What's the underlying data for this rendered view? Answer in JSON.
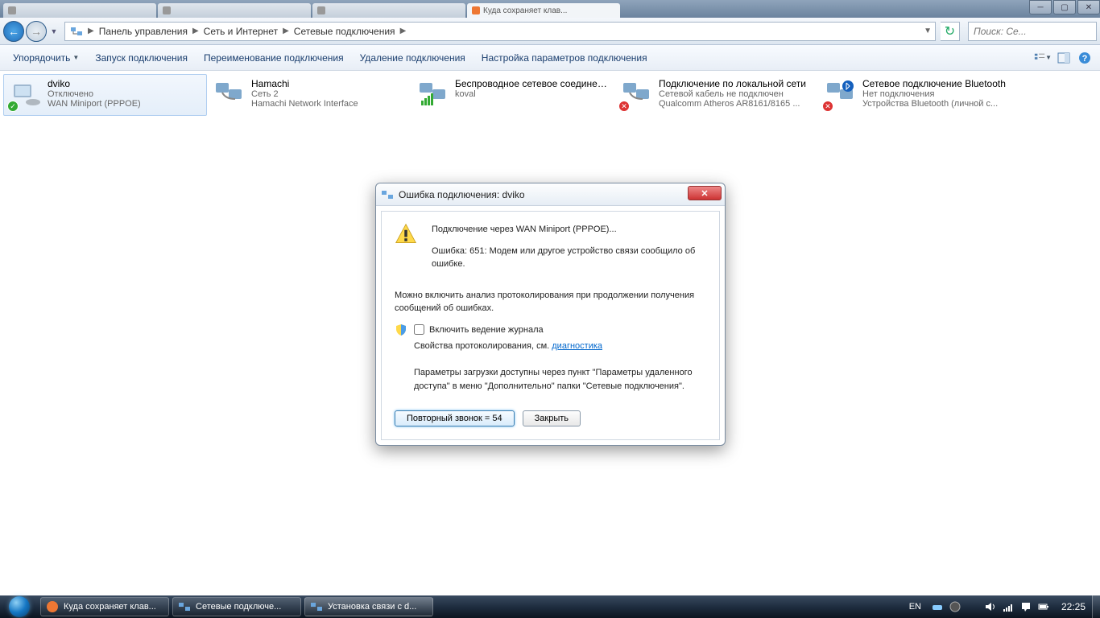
{
  "window_controls": {
    "min": "─",
    "max": "▢",
    "close": "✕"
  },
  "browser_tabs": [
    {
      "label": ""
    },
    {
      "label": ""
    },
    {
      "label": ""
    },
    {
      "label": "Куда сохраняет клав..."
    }
  ],
  "breadcrumb": {
    "root": "Панель управления",
    "items": [
      "Сеть и Интернет",
      "Сетевые подключения"
    ]
  },
  "search_placeholder": "Поиск: Се...",
  "toolbar": {
    "organize": "Упорядочить",
    "start": "Запуск подключения",
    "rename": "Переименование подключения",
    "delete": "Удаление подключения",
    "settings": "Настройка параметров подключения"
  },
  "connections": [
    {
      "name": "dviko",
      "status": "Отключено",
      "detail": "WAN Miniport (PPPOE)",
      "overlay": "green",
      "selected": true
    },
    {
      "name": "Hamachi",
      "status": "Сеть 2",
      "detail": "Hamachi Network Interface",
      "overlay": "",
      "selected": false
    },
    {
      "name": "Беспроводное сетевое соединение",
      "status": "koval",
      "detail": "",
      "overlay": "",
      "selected": false
    },
    {
      "name": "Подключение по локальной сети",
      "status": "Сетевой кабель не подключен",
      "detail": "Qualcomm Atheros AR8161/8165 ...",
      "overlay": "red",
      "selected": false
    },
    {
      "name": "Сетевое подключение Bluetooth",
      "status": "Нет подключения",
      "detail": "Устройства Bluetooth (личной с...",
      "overlay": "red",
      "selected": false
    }
  ],
  "dialog": {
    "title": "Ошибка подключения: dviko",
    "line1": "Подключение через WAN Miniport (PPPOE)...",
    "line2": "Ошибка: 651: Модем или другое устройство связи сообщило об ошибке.",
    "hint": "Можно включить анализ протоколирования при продолжении получения сообщений об ошибках.",
    "checkbox_label": "Включить ведение журнала",
    "props_prefix": "Свойства протоколирования, см. ",
    "props_link": "диагностика",
    "params": "Параметры загрузки доступны через пункт \"Параметры удаленного доступа\" в меню \"Дополнительно\" папки \"Сетевые подключения\".",
    "btn_redial": "Повторный звонок = 54",
    "btn_close": "Закрыть"
  },
  "taskbar": {
    "tasks": [
      {
        "label": "Куда сохраняет клав..."
      },
      {
        "label": "Сетевые подключе..."
      },
      {
        "label": "Установка связи с d..."
      }
    ],
    "lang": "EN",
    "clock": "22:25"
  }
}
